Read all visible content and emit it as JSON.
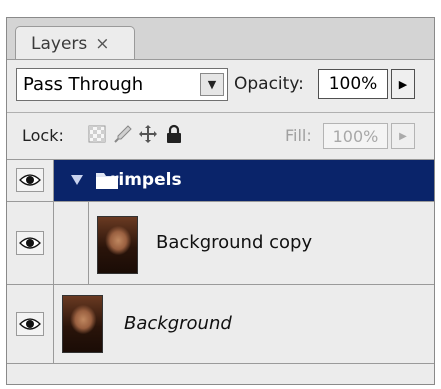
{
  "tab": {
    "label": "Layers",
    "close": "×"
  },
  "controls": {
    "blend_mode": "Pass Through",
    "opacity_label": "Opacity:",
    "opacity_value": "100%",
    "lock_label": "Lock:",
    "fill_label": "Fill:",
    "fill_value": "100%"
  },
  "layers": [
    {
      "name": "rimpels",
      "type": "group",
      "expanded": true,
      "selected": true,
      "visible": true
    },
    {
      "name": "Background copy",
      "type": "pixel",
      "visible": true
    },
    {
      "name": "Background",
      "type": "background",
      "visible": true
    }
  ],
  "colors": {
    "selection": "#0a246a",
    "panel": "#ececec"
  }
}
